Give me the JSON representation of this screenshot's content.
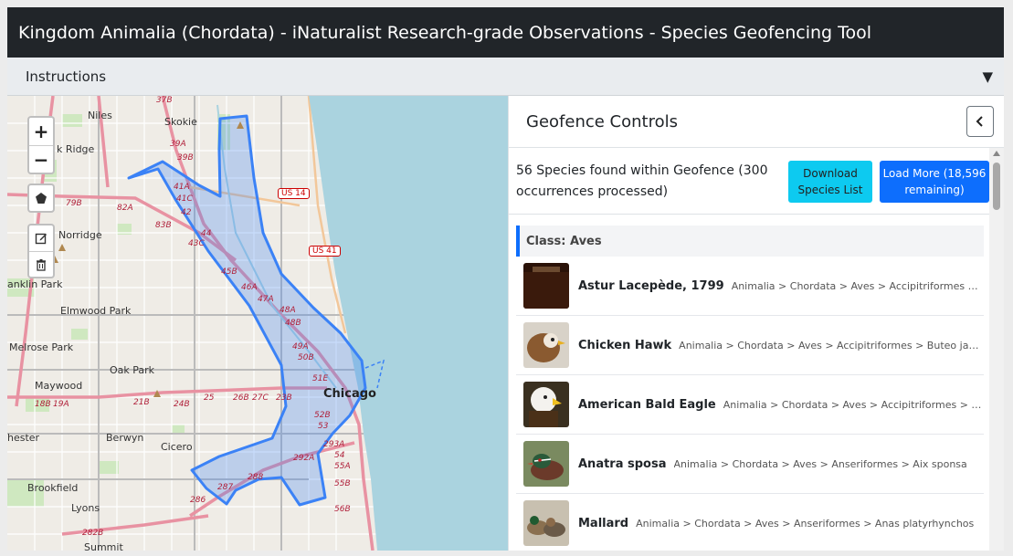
{
  "title": "Kingdom Animalia (Chordata) - iNaturalist Research-grade Observations - Species Geofencing Tool",
  "instructions": {
    "label": "Instructions",
    "toggle": "▼"
  },
  "map": {
    "zoom_in": "+",
    "zoom_out": "−",
    "labels": {
      "niles": "Niles",
      "skokie": "Skokie",
      "ridge": "k Ridge",
      "norridge": "Norridge",
      "franklin": "anklin Park",
      "elmwood": "Elmwood Park",
      "melrose": "Melrose Park",
      "oakpark": "Oak Park",
      "maywood": "Maywood",
      "berwyn": "Berwyn",
      "cicero": "Cicero",
      "brookfield": "Brookfield",
      "lyons": "Lyons",
      "summit": "Summit",
      "hester": "hester",
      "chicago": "Chicago"
    },
    "shields": {
      "us14": "US 14",
      "us41": "US 41"
    },
    "exits": [
      "37B",
      "39A",
      "39B",
      "41A",
      "41C",
      "42",
      "43C",
      "44",
      "45B",
      "46A",
      "47A",
      "48A",
      "48B",
      "49A",
      "50B",
      "51E",
      "52B",
      "53",
      "293A",
      "54",
      "55A",
      "55B",
      "56B",
      "292A",
      "288",
      "287",
      "286",
      "82A",
      "79B",
      "83B",
      "21B",
      "24B",
      "25",
      "26B",
      "27C",
      "23B",
      "19A",
      "18B",
      "282B",
      "37B"
    ]
  },
  "panel": {
    "title": "Geofence Controls",
    "collapse": "‹",
    "summary": "56 Species found within Geofence (300 occurrences processed)",
    "download_label": "Download Species List",
    "load_more_label": "Load More (18,596 remaining)",
    "class_heading": "Class: Aves",
    "species": [
      {
        "name": "Astur Lacepède, 1799",
        "taxonomy": "Animalia > Chordata > Aves > Accipitriformes > Astur"
      },
      {
        "name": "Chicken Hawk",
        "taxonomy": "Animalia > Chordata > Aves > Accipitriformes > Buteo jamaicensis"
      },
      {
        "name": "American Bald Eagle",
        "taxonomy": "Animalia > Chordata > Aves > Accipitriformes > Haliaeetus"
      },
      {
        "name": "Anatra sposa",
        "taxonomy": "Animalia > Chordata > Aves > Anseriformes > Aix sponsa"
      },
      {
        "name": "Mallard",
        "taxonomy": "Animalia > Chordata > Aves > Anseriformes > Anas platyrhynchos"
      }
    ]
  },
  "colors": {
    "titlebar": "#212529",
    "accent": "#0d6efd",
    "info": "#0dcaf0",
    "lake": "#aad3df",
    "geofence": "#3b82f6"
  }
}
